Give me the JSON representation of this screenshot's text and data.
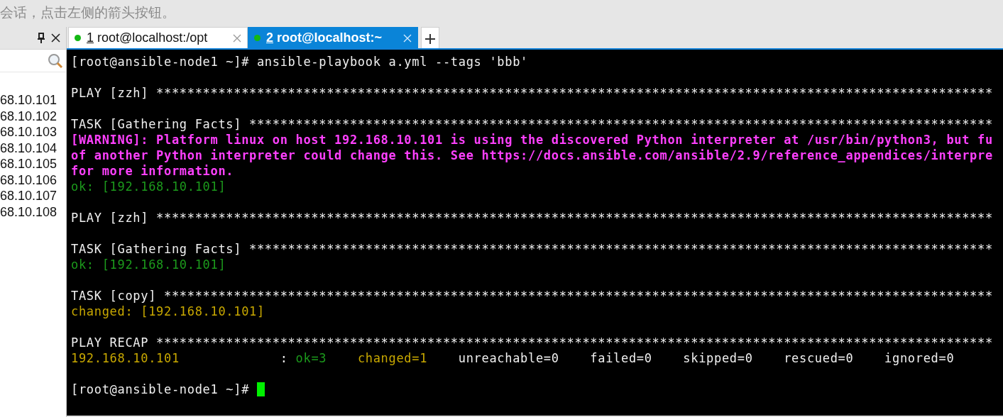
{
  "hint_bar": {
    "text": "会话，点击左侧的箭头按钮。"
  },
  "session_panel": {
    "hosts": [
      "68.10.101",
      "68.10.102",
      "68.10.103",
      "68.10.104",
      "68.10.105",
      "68.10.106",
      "68.10.107",
      "68.10.108"
    ]
  },
  "tabs": [
    {
      "number": "1",
      "label": "root@localhost:/opt",
      "selected": false,
      "connected": true
    },
    {
      "number": "2",
      "label": "root@localhost:~",
      "selected": true,
      "connected": true
    }
  ],
  "terminal": {
    "lines": [
      {
        "space_before": false,
        "segments": [
          {
            "kind": "plain",
            "text": "[root@ansible-node1 ~]# ansible-playbook a.yml --tags 'bbb'"
          }
        ]
      },
      {
        "space_before": true,
        "segments": [
          {
            "kind": "plain",
            "text": "PLAY [zzh] ************************************************************************************************************"
          }
        ]
      },
      {
        "space_before": true,
        "segments": [
          {
            "kind": "plain",
            "text": "TASK [Gathering Facts] ************************************************************************************************"
          }
        ]
      },
      {
        "space_before": false,
        "segments": [
          {
            "kind": "warning",
            "text": "[WARNING]: Platform linux on host 192.168.10.101 is using the discovered Python interpreter at /usr/bin/python3, but fu"
          }
        ]
      },
      {
        "space_before": false,
        "segments": [
          {
            "kind": "warning",
            "text": "of another Python interpreter could change this. See https://docs.ansible.com/ansible/2.9/reference_appendices/interpre"
          }
        ]
      },
      {
        "space_before": false,
        "segments": [
          {
            "kind": "warning",
            "text": "for more information."
          }
        ]
      },
      {
        "space_before": false,
        "segments": [
          {
            "kind": "ok",
            "text": "ok: [192.168.10.101]"
          }
        ]
      },
      {
        "space_before": true,
        "segments": [
          {
            "kind": "plain",
            "text": "PLAY [zzh] ************************************************************************************************************"
          }
        ]
      },
      {
        "space_before": true,
        "segments": [
          {
            "kind": "plain",
            "text": "TASK [Gathering Facts] ************************************************************************************************"
          }
        ]
      },
      {
        "space_before": false,
        "segments": [
          {
            "kind": "ok",
            "text": "ok: [192.168.10.101]"
          }
        ]
      },
      {
        "space_before": true,
        "segments": [
          {
            "kind": "plain",
            "text": "TASK [copy] ***********************************************************************************************************"
          }
        ]
      },
      {
        "space_before": false,
        "segments": [
          {
            "kind": "changed",
            "text": "changed: [192.168.10.101]"
          }
        ]
      },
      {
        "space_before": true,
        "segments": [
          {
            "kind": "plain",
            "text": "PLAY RECAP ************************************************************************************************************"
          }
        ]
      },
      {
        "space_before": false,
        "segments": [
          {
            "kind": "changed",
            "text": "192.168.10.101"
          },
          {
            "kind": "plain",
            "text": "             : "
          },
          {
            "kind": "ok",
            "text": "ok=3"
          },
          {
            "kind": "changed",
            "text": "    changed=1"
          },
          {
            "kind": "plain",
            "text": "    unreachable=0    failed=0    skipped=0    rescued=0    ignored=0"
          }
        ]
      },
      {
        "space_before": true,
        "cursor": true,
        "segments": [
          {
            "kind": "plain",
            "text": "[root@ansible-node1 ~]# "
          }
        ]
      }
    ]
  }
}
